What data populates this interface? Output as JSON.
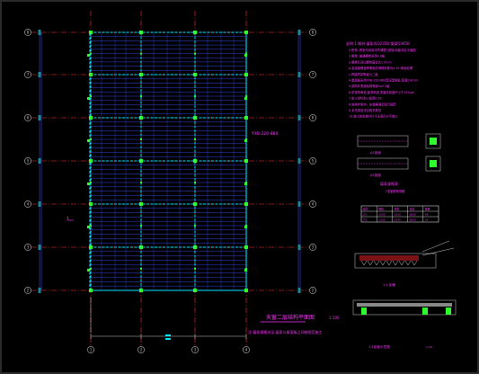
{
  "colors": {
    "background": "#000000",
    "axis_line": "#ff3333",
    "axis_bubble": "#c0c0c0",
    "beam": "#00e5ff",
    "purlin": "#3a4dff",
    "hatch": "#00e5ff",
    "node": "#2fff2f",
    "annotation": "#ff33ff",
    "dimension": "#ffffff"
  },
  "plan": {
    "row_bubble_labels": [
      "8",
      "7",
      "6",
      "5",
      "4",
      "3",
      "2",
      "1"
    ],
    "column_bubble_labels": [
      "1",
      "2",
      "3",
      "4"
    ],
    "callout_label": "YXB-220-880",
    "section_mark": "1",
    "title": "天窗二层结构平面图",
    "title_scale": "1:100",
    "note": "注:檩条规格详见,檩条与屋面板之间按规范施工"
  },
  "notes": {
    "heading": "说明:1.钢材:檩条为Q235B,钢梁Q345B",
    "lines": [
      "2.檩条: 檩条均采用冷弯薄壁C型钢,间距详见平面图",
      "3.螺栓: 普通螺栓采用4.6级",
      "  a.螺栓孔径比螺栓直径大1.5mm",
      "  b.高强度螺栓摩擦面抗滑移系数为0.45,喷砂处理",
      "  c.焊缝质量等级为二级",
      "4.屋面板采用YXB-220-880型压型钢板,厚度0.8mm",
      "5.钢构件表面除锈等级Sa2.5级",
      "6.防锈漆两道,面漆两道,漆膜总厚度不小于125μm",
      "7.防火涂料耐火极限1.5h",
      "8.钢构件制作、安装需满足现行规范",
      "9.未尽事宜详见相关规范",
      "10.施工前应核对尺寸无误后方可施工"
    ]
  },
  "details": {
    "detail_a_label": "A1剖面",
    "detail_b_label": "A2剖面",
    "table_title": "檩条规格表",
    "table_subtitle": "C型钢檩条规格",
    "table_rows": [
      [
        "编号",
        "规格",
        "材质",
        "长度",
        "数量"
      ],
      [
        "LT1",
        "C200",
        "Q235",
        "6000",
        "48"
      ],
      [
        "LT2",
        "C160",
        "Q235",
        "6000",
        "24"
      ]
    ],
    "section_c_label": "1-1 剖面",
    "section_d_label": "1-1剖面示意图",
    "section_d_scale": "1:20"
  }
}
